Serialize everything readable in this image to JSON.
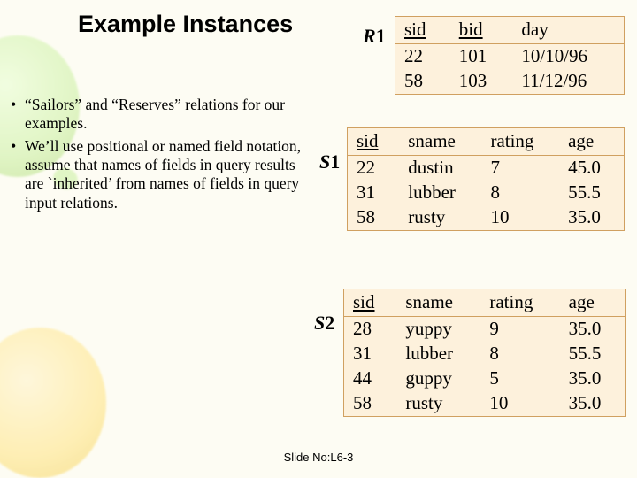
{
  "title": "Example Instances",
  "bullets": [
    "“Sailors” and “Reserves” relations for our examples.",
    "We’ll use positional or named field notation, assume that names of fields in query results are `inherited’ from names of fields in query input relations."
  ],
  "labels": {
    "r1": "R1",
    "s1": "S1",
    "s2": "S2"
  },
  "slide_no": "Slide No:L6-3",
  "chart_data": [
    {
      "type": "table",
      "name": "R1",
      "columns": [
        "sid",
        "bid",
        "day"
      ],
      "underlined": [
        "sid",
        "bid"
      ],
      "rows": [
        [
          "22",
          "101",
          "10/10/96"
        ],
        [
          "58",
          "103",
          "11/12/96"
        ]
      ]
    },
    {
      "type": "table",
      "name": "S1",
      "columns": [
        "sid",
        "sname",
        "rating",
        "age"
      ],
      "underlined": [
        "sid"
      ],
      "rows": [
        [
          "22",
          "dustin",
          "7",
          "45.0"
        ],
        [
          "31",
          "lubber",
          "8",
          "55.5"
        ],
        [
          "58",
          "rusty",
          "10",
          "35.0"
        ]
      ]
    },
    {
      "type": "table",
      "name": "S2",
      "columns": [
        "sid",
        "sname",
        "rating",
        "age"
      ],
      "underlined": [
        "sid"
      ],
      "rows": [
        [
          "28",
          "yuppy",
          "9",
          "35.0"
        ],
        [
          "31",
          "lubber",
          "8",
          "55.5"
        ],
        [
          "44",
          "guppy",
          "5",
          "35.0"
        ],
        [
          "58",
          "rusty",
          "10",
          "35.0"
        ]
      ]
    }
  ]
}
